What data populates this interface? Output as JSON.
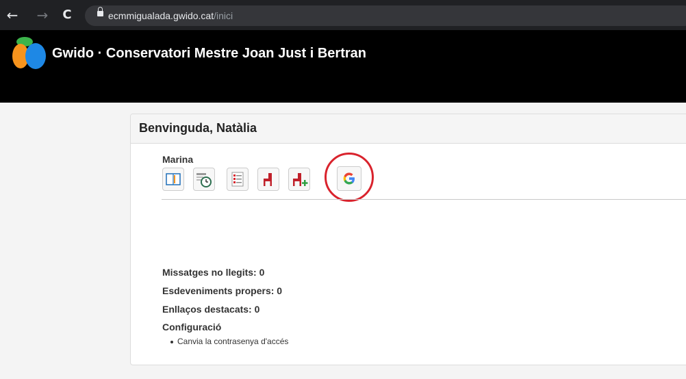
{
  "browser": {
    "back_icon": "back-arrow-icon",
    "back_glyph": "←",
    "forward_glyph": "→",
    "reload_glyph": "C",
    "url_domain": "ecmmigualada.gwido.cat",
    "url_path": "/inici"
  },
  "header": {
    "title": "Gwido · Conservatori Mestre Joan Just i Bertran",
    "logo_colors": [
      "#3cb44b",
      "#f7941d",
      "#1e88e5"
    ]
  },
  "panel": {
    "title": "Benvinguda, Natàlia",
    "student_name": "Marina",
    "tool_icons": [
      "book-icon",
      "schedule-clock-icon",
      "document-checklist-icon",
      "chair-icon",
      "add-chair-icon",
      "google-icon"
    ],
    "highlighted_icon": "google-icon",
    "highlight_color": "#d9232d",
    "summary": {
      "unread_messages": "Missatges no llegits: 0",
      "upcoming_events": "Esdeveniments propers: 0",
      "featured_links": "Enllaços destacats: 0",
      "configuration": "Configuració"
    },
    "configuration_items": [
      "Canvia la contrasenya d'accés"
    ]
  }
}
